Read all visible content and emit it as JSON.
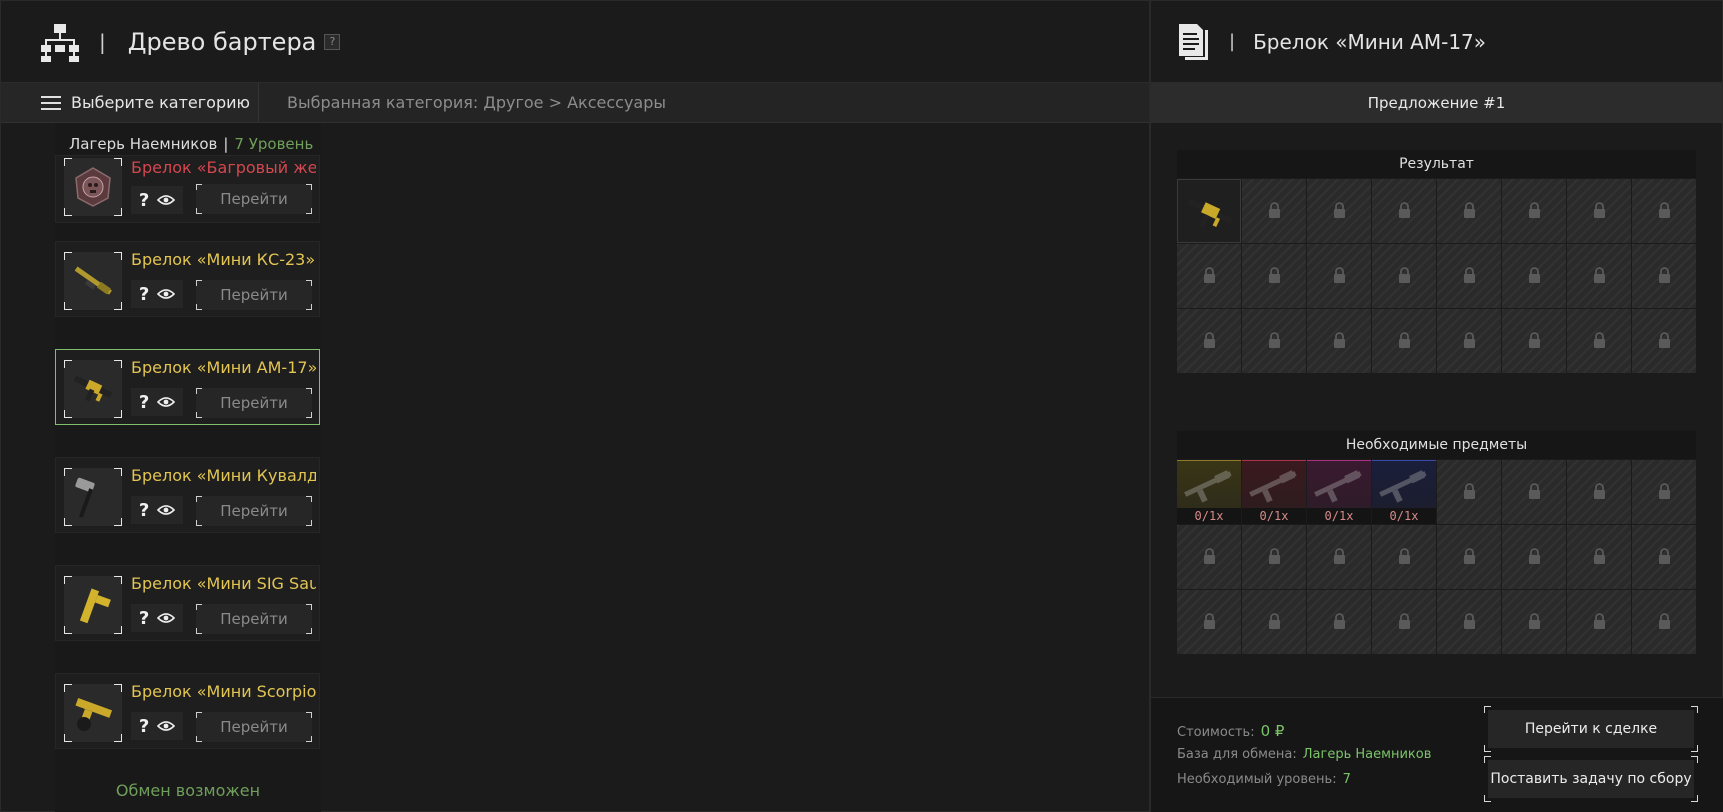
{
  "left_header": {
    "title": "Древо бартера",
    "help": "?",
    "separator": "|"
  },
  "toolbar": {
    "category_button": "Выберите категорию",
    "selected_category": "Выбранная категория: Другое > Аксессуары"
  },
  "trader": {
    "name": "Лагерь Наемников",
    "separator": "|",
    "level": "7 Уровень"
  },
  "items": [
    {
      "name": "Брелок «Багровый жет..",
      "question": "?",
      "go": "Перейти",
      "color": "#d4474f",
      "icon": "badge-icon",
      "selected": false
    },
    {
      "name": "Брелок «Мини КС-23»",
      "question": "?",
      "go": "Перейти",
      "color": "#e2c552",
      "icon": "shotgun-icon",
      "selected": false
    },
    {
      "name": "Брелок «Мини АМ-17»",
      "question": "?",
      "go": "Перейти",
      "color": "#e2c552",
      "icon": "rifle-icon",
      "selected": true
    },
    {
      "name": "Брелок «Мини Кувалд..",
      "question": "?",
      "go": "Перейти",
      "color": "#e2c552",
      "icon": "sledgehammer-icon",
      "selected": false
    },
    {
      "name": "Брелок «Мини SIG Sau..",
      "question": "?",
      "go": "Перейти",
      "color": "#e2c552",
      "icon": "pistol-icon",
      "selected": false
    },
    {
      "name": "Брелок «Мини Scorpio..",
      "question": "?",
      "go": "Перейти",
      "color": "#e2c552",
      "icon": "smg-icon",
      "selected": false
    }
  ],
  "exchange_status": "Обмен возможен",
  "right_header": {
    "title": "Брелок «Мини АМ-17»",
    "separator": "|"
  },
  "offer": {
    "label": "Предложение #1"
  },
  "result": {
    "title": "Результат"
  },
  "required": {
    "title": "Необходимые предметы",
    "items": [
      {
        "count": "0/1x",
        "tint": "yellow"
      },
      {
        "count": "0/1x",
        "tint": "red"
      },
      {
        "count": "0/1x",
        "tint": "magenta"
      },
      {
        "count": "0/1x",
        "tint": "blue"
      }
    ]
  },
  "footer": {
    "cost_label": "Стоимость:",
    "cost_value": "0 ₽",
    "base_label": "База для обмена:",
    "base_value": "Лагерь Наемников",
    "level_label": "Необходимый уровень:",
    "level_value": "7",
    "goto_deal": "Перейти к сделке",
    "set_task": "Поставить задачу по сбору"
  },
  "colors": {
    "accent_green": "#7cc46a",
    "item_yellow": "#e2c552",
    "item_red": "#d4474f",
    "selected_border": "#7fbf6a"
  }
}
